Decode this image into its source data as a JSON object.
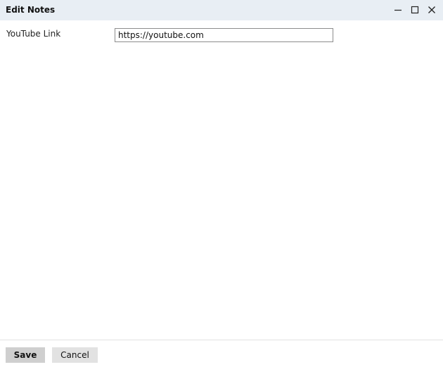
{
  "dialog": {
    "title": "Edit Notes",
    "controls": {
      "minimize": "minimize-icon",
      "maximize": "maximize-icon",
      "close": "close-icon"
    }
  },
  "form": {
    "youtube_label": "YouTube Link",
    "youtube_value": "https://youtube.com"
  },
  "footer": {
    "save_label": "Save",
    "cancel_label": "Cancel"
  },
  "colors": {
    "titlebar_bg": "#e8eef4",
    "button_bg": "#dcdcdc"
  }
}
